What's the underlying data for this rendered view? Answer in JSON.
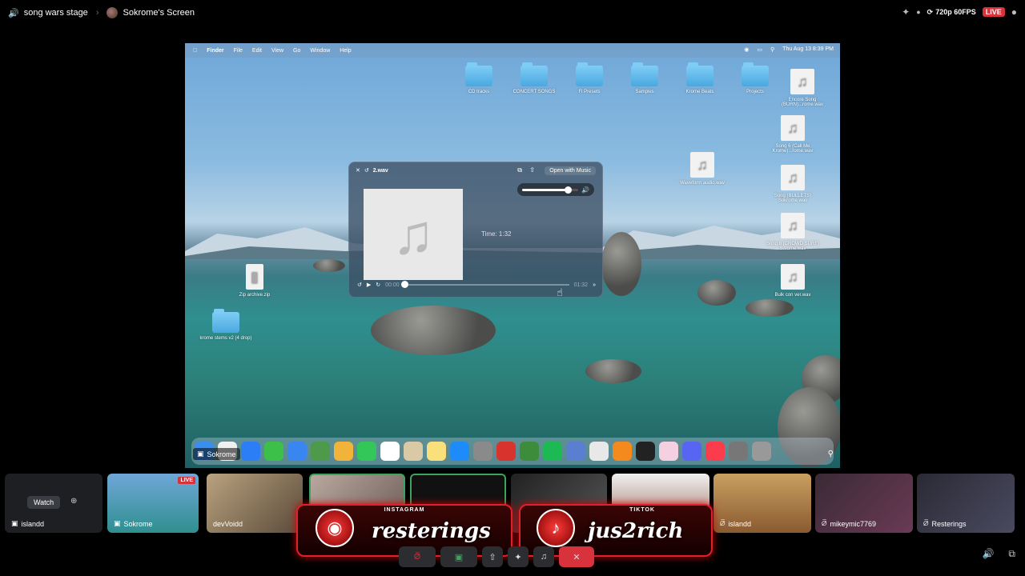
{
  "topbar": {
    "stage_name": "song wars stage",
    "screen_owner": "Sokrome's Screen",
    "quality": "720p 60FPS",
    "live": "LIVE"
  },
  "screen": {
    "menubar": {
      "app": "Finder",
      "items": [
        "File",
        "Edit",
        "View",
        "Go",
        "Window",
        "Help"
      ],
      "clock": "Thu Aug 13  8:39 PM"
    },
    "folders": [
      {
        "label": "CD tracks"
      },
      {
        "label": "CONCERT SONGS"
      },
      {
        "label": "Fl Presets"
      },
      {
        "label": "Samples"
      },
      {
        "label": "Krome Beats"
      },
      {
        "label": "Projects"
      }
    ],
    "files": [
      {
        "label": "Encore Song (BURN)...rome.wav"
      },
      {
        "label": "Song 6 (Call Me Krome)...rome.wav"
      },
      {
        "label": "Song (BULLETS) Sokrome.wav"
      },
      {
        "label": "Song 8 (CROWD SURF) S...ome.wav"
      },
      {
        "label": "Bulk con ver.wav"
      },
      {
        "label": "Waveform audio.wav"
      },
      {
        "label": "Zip archive.zip"
      },
      {
        "label": "krome stems v2 (4 drop)"
      }
    ],
    "player": {
      "filename": "2.wav",
      "open_with": "Open with Music",
      "time_label": "Time: 1:32",
      "elapsed": "00:00",
      "duration": "01:32",
      "volume": 0.82,
      "progress": 0.0
    },
    "presenter_label": "Sokrome",
    "dock_colors": [
      "#3a8ef0",
      "#f0f0f0",
      "#2c7ef6",
      "#3cc04a",
      "#3a86f0",
      "#4c9a4a",
      "#f2b33a",
      "#33c759",
      "#ffffff",
      "#d9c9a5",
      "#f9e07a",
      "#1d8cf8",
      "#8a8a8a",
      "#d9332e",
      "#3c8c3c",
      "#1db954",
      "#5a7fd0",
      "#e8e8e8",
      "#f48a1e",
      "#222",
      "#f5d0e0",
      "#5865f2",
      "#fa3c4c",
      "#777",
      "#999"
    ]
  },
  "participants": [
    {
      "name": "islandd",
      "watch": "Watch"
    },
    {
      "name": "Sokrome",
      "live": "LIVE"
    },
    {
      "name": "devVoidd"
    },
    {
      "name": ""
    },
    {
      "name": ""
    },
    {
      "name": ""
    },
    {
      "name": ""
    },
    {
      "name": "islandd"
    },
    {
      "name": "mikeymic7769"
    },
    {
      "name": "Resterings"
    }
  ],
  "banner": {
    "instagram_tag": "INSTAGRAM",
    "instagram_handle": "resterings",
    "tiktok_tag": "TIKTOK",
    "tiktok_handle": "jus2rich"
  }
}
